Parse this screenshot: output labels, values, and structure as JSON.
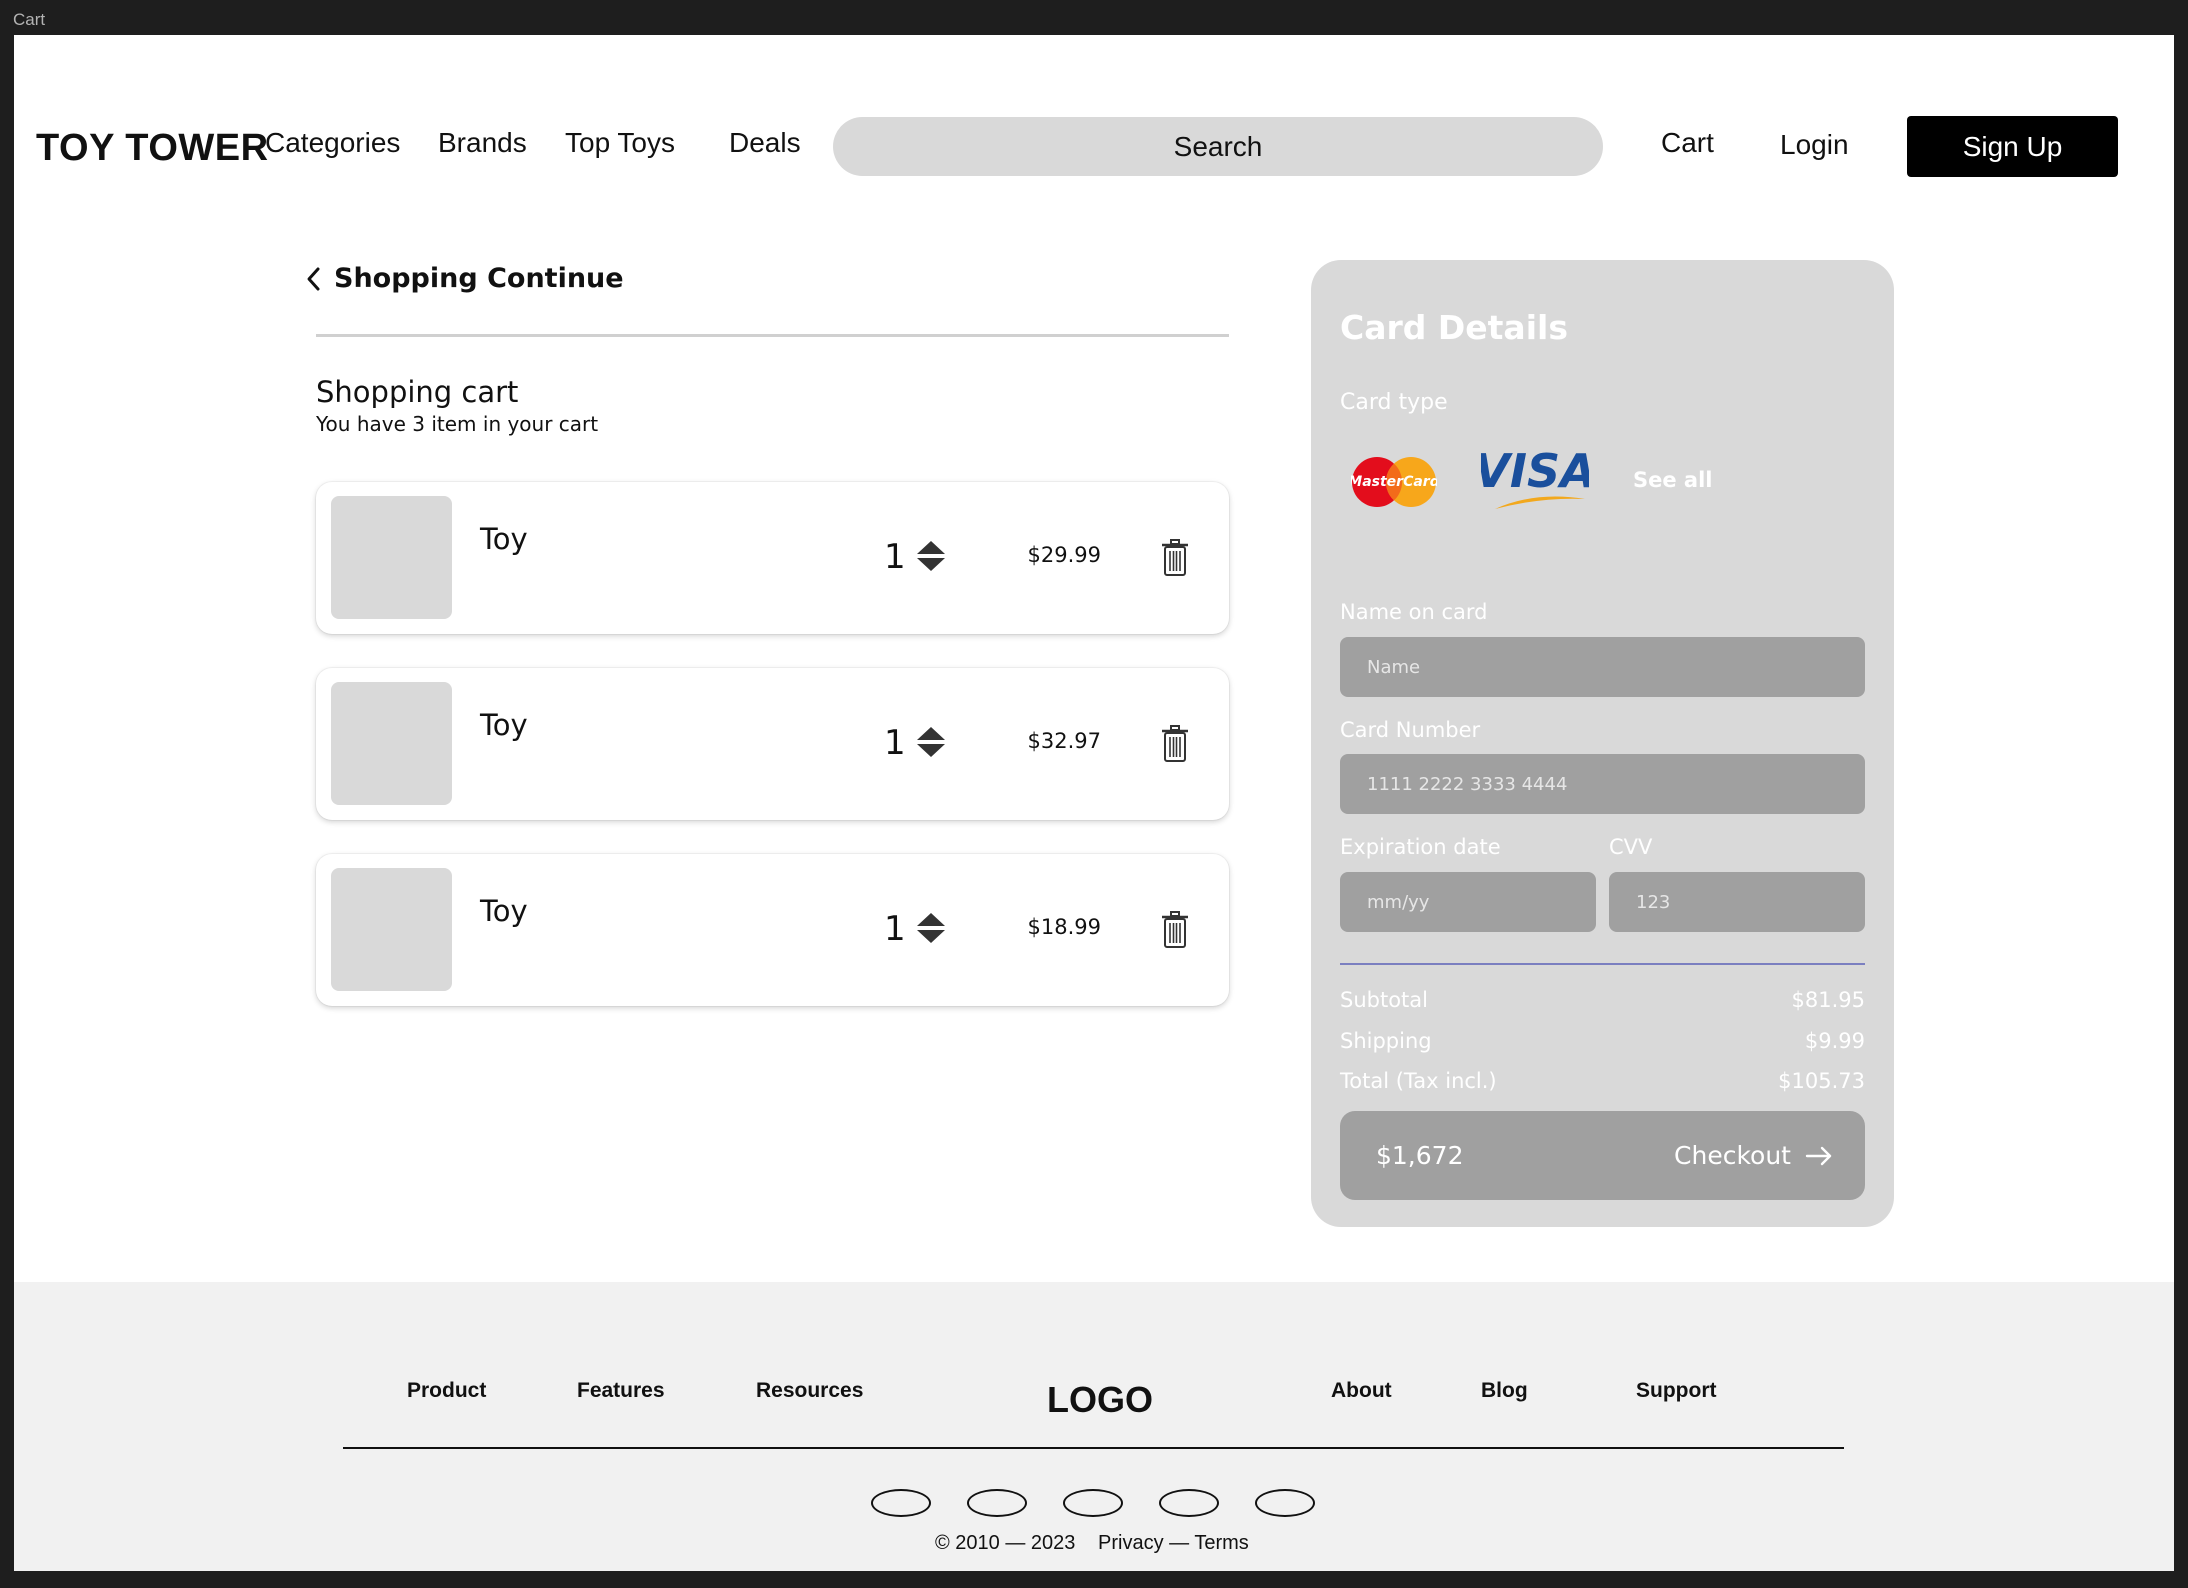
{
  "window": {
    "frame_label": "Cart"
  },
  "header": {
    "logo": "TOY TOWER",
    "nav": [
      "Categories",
      "Brands",
      "Top Toys",
      "Deals"
    ],
    "search_label": "Search",
    "cart": "Cart",
    "login": "Login",
    "signup": "Sign Up"
  },
  "cart": {
    "back_label": "Shopping Continue",
    "title": "Shopping cart",
    "subtitle": "You have 3 item in your cart",
    "items": [
      {
        "name": "Toy",
        "qty": "1",
        "price": "$29.99"
      },
      {
        "name": "Toy",
        "qty": "1",
        "price": "$32.97"
      },
      {
        "name": "Toy",
        "qty": "1",
        "price": "$18.99"
      }
    ]
  },
  "card_details": {
    "title": "Card Details",
    "card_type_label": "Card type",
    "mastercard_text": "MasterCard",
    "visa_text": "VISA",
    "see_all": "See all",
    "name_label": "Name on card",
    "name_placeholder": "Name",
    "number_label": "Card Number",
    "number_placeholder": "1111 2222 3333 4444",
    "expiry_label": "Expiration date",
    "expiry_placeholder": "mm/yy",
    "cvv_label": "CVV",
    "cvv_placeholder": "123",
    "subtotal_label": "Subtotal",
    "subtotal_value": "$81.95",
    "shipping_label": "Shipping",
    "shipping_value": "$9.99",
    "total_label": "Total (Tax incl.)",
    "total_value": "$105.73",
    "checkout_amount": "$1,672",
    "checkout_label": "Checkout"
  },
  "footer": {
    "links_left": [
      "Product",
      "Features",
      "Resources"
    ],
    "logo": "LOGO",
    "links_right": [
      "About",
      "Blog",
      "Support"
    ],
    "copyright": "© 2010 — 2023",
    "legal": "Privacy — Terms"
  },
  "colors": {
    "panel_bg": "#d9d9d9",
    "field_bg": "#a0a0a0",
    "separator": "#7b7fc0",
    "footer_bg": "#f1f1f1",
    "signup_bg": "#000000"
  }
}
